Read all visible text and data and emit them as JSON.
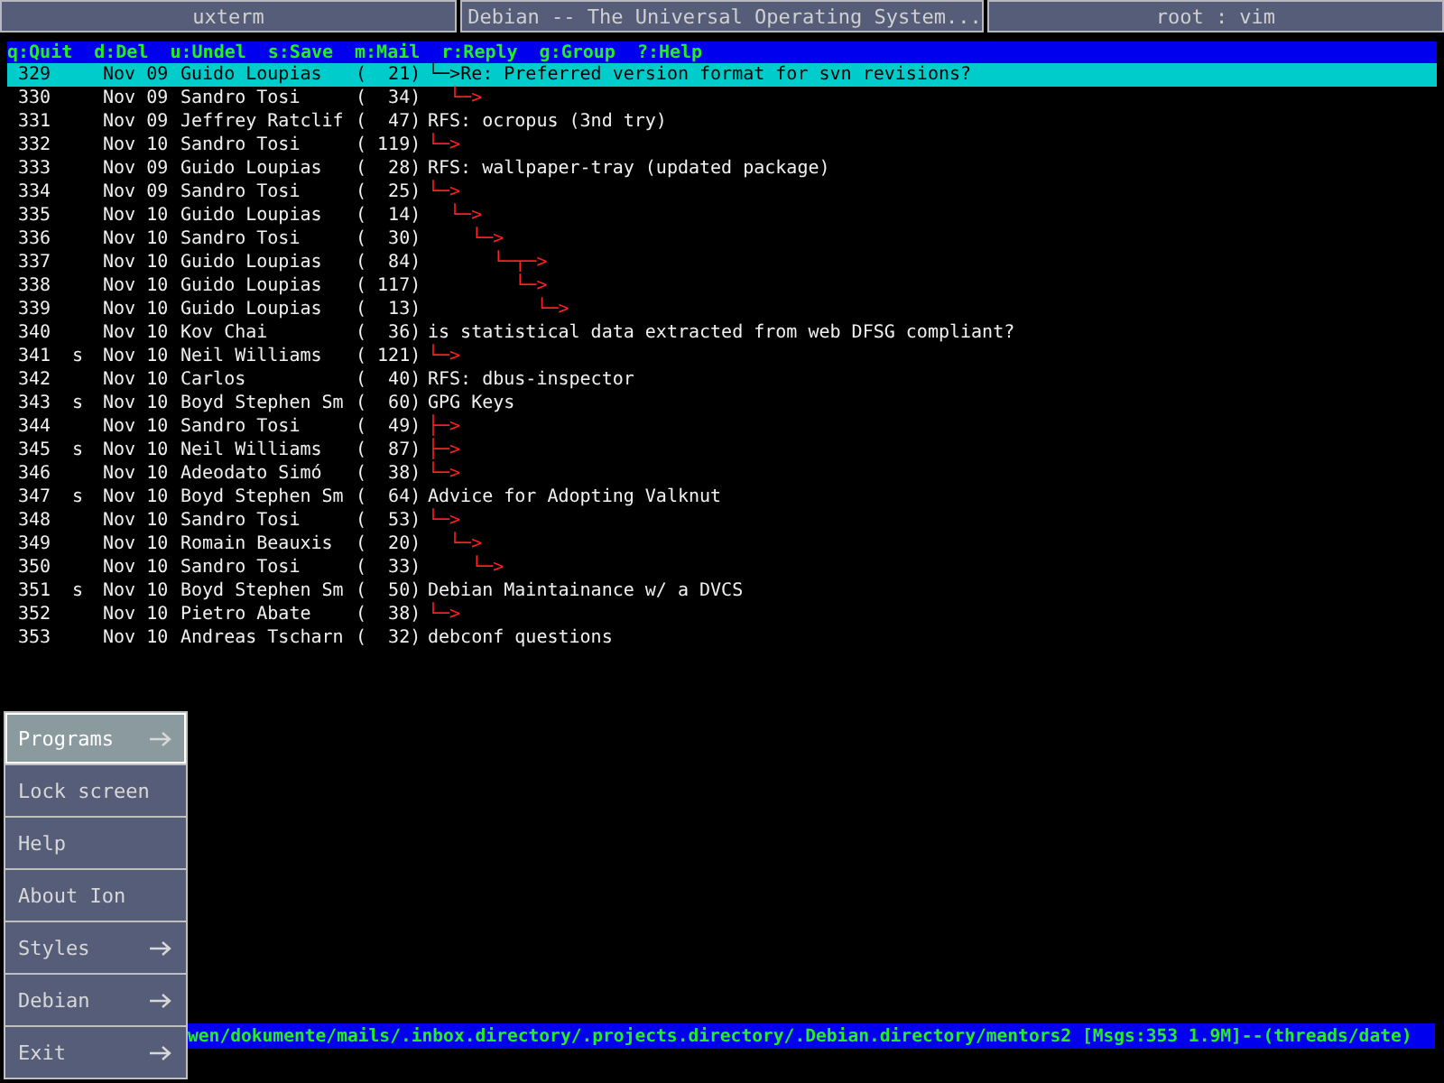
{
  "tabs": [
    {
      "label": "uxterm"
    },
    {
      "label": "Debian -- The Universal Operating System..."
    },
    {
      "label": "root : vim"
    }
  ],
  "help_bar": [
    "q:Quit",
    "d:Del",
    "u:Undel",
    "s:Save",
    "m:Mail",
    "r:Reply",
    "g:Group",
    "?:Help"
  ],
  "messages": [
    {
      "number": "329",
      "date": "Nov 09",
      "author": "Guido Loupias",
      "size": "(  21)",
      "tree": "└─>",
      "subject": "Re: Preferred version format for svn revisions?",
      "selected": true
    },
    {
      "number": "330",
      "date": "Nov 09",
      "author": "Sandro Tosi",
      "size": "(  34)",
      "tree": "  └─>",
      "selected": false
    },
    {
      "number": "331",
      "date": "Nov 09",
      "author": "Jeffrey Ratclif",
      "size": "(  47)",
      "subject": "RFS: ocropus (3nd try)",
      "selected": false
    },
    {
      "number": "332",
      "date": "Nov 10",
      "author": "Sandro Tosi",
      "size": "( 119)",
      "tree": "└─>",
      "selected": false
    },
    {
      "number": "333",
      "date": "Nov 09",
      "author": "Guido Loupias",
      "size": "(  28)",
      "subject": "RFS: wallpaper-tray (updated package)",
      "selected": false
    },
    {
      "number": "334",
      "date": "Nov 09",
      "author": "Sandro Tosi",
      "size": "(  25)",
      "tree": "└─>",
      "selected": false
    },
    {
      "number": "335",
      "date": "Nov 10",
      "author": "Guido Loupias",
      "size": "(  14)",
      "tree": "  └─>",
      "selected": false
    },
    {
      "number": "336",
      "date": "Nov 10",
      "author": "Sandro Tosi",
      "size": "(  30)",
      "tree": "    └─>",
      "selected": false
    },
    {
      "number": "337",
      "date": "Nov 10",
      "author": "Guido Loupias",
      "size": "(  84)",
      "tree": "      └─┬─>",
      "selected": false
    },
    {
      "number": "338",
      "date": "Nov 10",
      "author": "Guido Loupias",
      "size": "( 117)",
      "tree": "        └─>",
      "selected": false
    },
    {
      "number": "339",
      "date": "Nov 10",
      "author": "Guido Loupias",
      "size": "(  13)",
      "tree": "          └─>",
      "selected": false
    },
    {
      "number": "340",
      "date": "Nov 10",
      "author": "Kov Chai",
      "size": "(  36)",
      "subject": "is statistical data extracted from web DFSG compliant?",
      "selected": false
    },
    {
      "number": "341",
      "flag": "s",
      "date": "Nov 10",
      "author": "Neil Williams",
      "size": "( 121)",
      "tree": "└─>",
      "selected": false
    },
    {
      "number": "342",
      "date": "Nov 10",
      "author": "Carlos",
      "size": "(  40)",
      "subject": "RFS: dbus-inspector",
      "selected": false
    },
    {
      "number": "343",
      "flag": "s",
      "date": "Nov 10",
      "author": "Boyd Stephen Sm",
      "size": "(  60)",
      "subject": "GPG Keys",
      "selected": false
    },
    {
      "number": "344",
      "date": "Nov 10",
      "author": "Sandro Tosi",
      "size": "(  49)",
      "tree": "├─>",
      "selected": false
    },
    {
      "number": "345",
      "flag": "s",
      "date": "Nov 10",
      "author": "Neil Williams",
      "size": "(  87)",
      "tree": "├─>",
      "selected": false
    },
    {
      "number": "346",
      "date": "Nov 10",
      "author": "Adeodato Simó",
      "size": "(  38)",
      "tree": "└─>",
      "selected": false
    },
    {
      "number": "347",
      "flag": "s",
      "date": "Nov 10",
      "author": "Boyd Stephen Sm",
      "size": "(  64)",
      "subject": "Advice for Adopting Valknut",
      "selected": false
    },
    {
      "number": "348",
      "date": "Nov 10",
      "author": "Sandro Tosi",
      "size": "(  53)",
      "tree": "└─>",
      "selected": false
    },
    {
      "number": "349",
      "date": "Nov 10",
      "author": "Romain Beauxis",
      "size": "(  20)",
      "tree": "  └─>",
      "selected": false
    },
    {
      "number": "350",
      "date": "Nov 10",
      "author": "Sandro Tosi",
      "size": "(  33)",
      "tree": "    └─>",
      "selected": false
    },
    {
      "number": "351",
      "flag": "s",
      "date": "Nov 10",
      "author": "Boyd Stephen Sm",
      "size": "(  50)",
      "subject": "Debian Maintainance w/ a DVCS",
      "selected": false
    },
    {
      "number": "352",
      "date": "Nov 10",
      "author": "Pietro Abate",
      "size": "(  38)",
      "tree": "└─>",
      "selected": false
    },
    {
      "number": "353",
      "date": "Nov 10",
      "author": "Andreas Tscharn",
      "size": "(  32)",
      "subject": "debconf questions",
      "selected": false
    }
  ],
  "status_bar": "wen/dokumente/mails/.inbox.directory/.projects.directory/.Debian.directory/mentors2 [Msgs:353 1.9M]--(threads/date)",
  "menu": [
    {
      "label": "Programs",
      "submenu": true,
      "selected": true
    },
    {
      "label": "Lock screen",
      "submenu": false,
      "selected": false
    },
    {
      "label": "Help",
      "submenu": false,
      "selected": false
    },
    {
      "label": "About Ion",
      "submenu": false,
      "selected": false
    },
    {
      "label": "Styles",
      "submenu": true,
      "selected": false
    },
    {
      "label": "Debian",
      "submenu": true,
      "selected": false
    },
    {
      "label": "Exit",
      "submenu": true,
      "selected": false
    }
  ]
}
